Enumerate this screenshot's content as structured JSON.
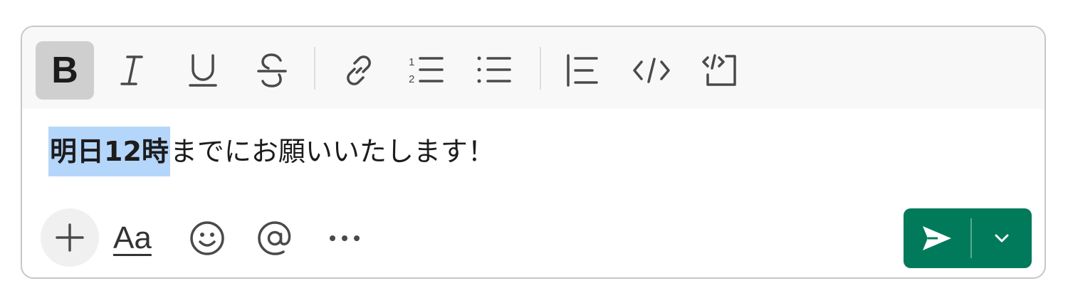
{
  "toolbar": {
    "items": [
      {
        "name": "bold",
        "icon": "bold-icon",
        "label": "B",
        "active": true
      },
      {
        "name": "italic",
        "icon": "italic-icon"
      },
      {
        "name": "underline",
        "icon": "underline-icon"
      },
      {
        "name": "strikethrough",
        "icon": "strikethrough-icon"
      },
      {
        "name": "link",
        "icon": "link-icon"
      },
      {
        "name": "ordered-list",
        "icon": "ordered-list-icon",
        "numbers": [
          "1",
          "2"
        ]
      },
      {
        "name": "bulleted-list",
        "icon": "bulleted-list-icon"
      },
      {
        "name": "blockquote",
        "icon": "blockquote-icon"
      },
      {
        "name": "code",
        "icon": "code-icon"
      },
      {
        "name": "code-block",
        "icon": "code-block-icon"
      }
    ]
  },
  "editor": {
    "selected_text": "明日12時",
    "rest_text": "までにお願いいたします！"
  },
  "bottom": {
    "format_label": "Aa",
    "icons": [
      "plus-icon",
      "emoji-icon",
      "mention-icon",
      "more-icon",
      "send-icon",
      "chevron-down-icon"
    ]
  },
  "colors": {
    "send_button": "#007a5a",
    "selection": "#b5d6fb",
    "active_toolbar_button": "#cfcfcf"
  }
}
